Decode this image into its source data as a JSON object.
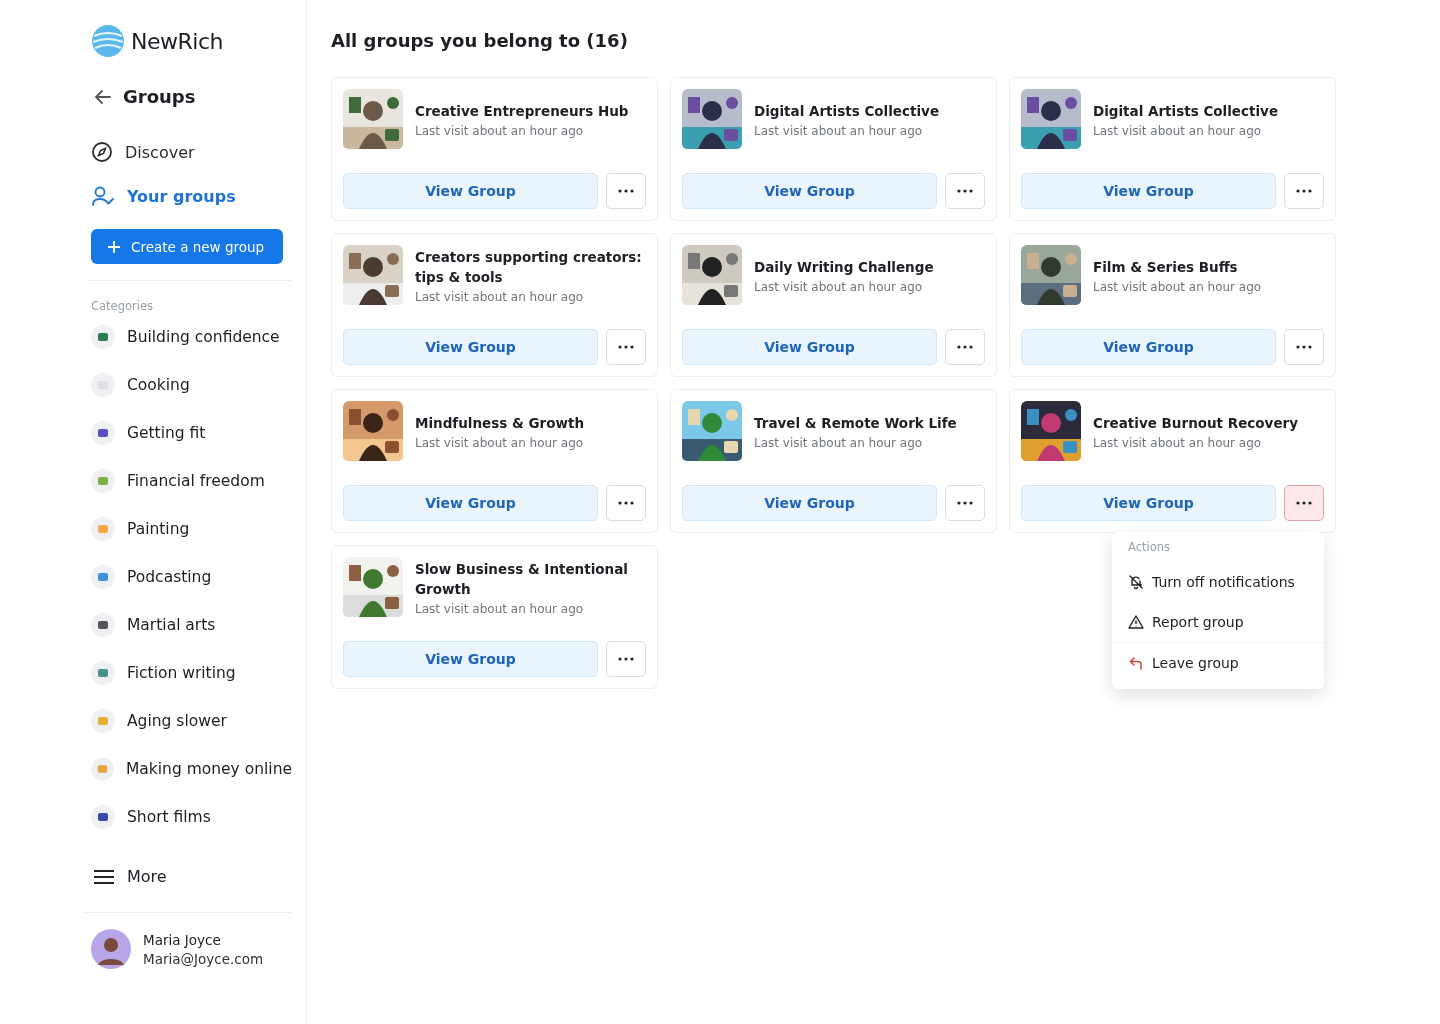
{
  "brand": {
    "name": "NewRich"
  },
  "back": {
    "label": "Groups"
  },
  "nav": [
    {
      "label": "Discover",
      "kind": "compass",
      "selected": false
    },
    {
      "label": "Your groups",
      "kind": "people",
      "selected": true
    }
  ],
  "create_button": {
    "label": "Create a new group"
  },
  "categories": {
    "heading": "Categories",
    "items": [
      {
        "label": "Building confidence"
      },
      {
        "label": "Cooking"
      },
      {
        "label": "Getting fit"
      },
      {
        "label": "Financial freedom"
      },
      {
        "label": "Painting"
      },
      {
        "label": "Podcasting"
      },
      {
        "label": "Martial arts"
      },
      {
        "label": "Fiction writing"
      },
      {
        "label": "Aging slower"
      },
      {
        "label": "Making money online"
      },
      {
        "label": "Short films"
      }
    ]
  },
  "more": {
    "label": "More"
  },
  "user": {
    "name": "Maria Joyce",
    "email": "Maria@Joyce.com"
  },
  "heading": "All groups you belong to (16)",
  "groups": [
    {
      "name": "Creative Entrepreneurs Hub",
      "last_visit": "Last visit about an hour ago",
      "button": "View Group",
      "menu_open": false
    },
    {
      "name": "Digital Artists Collective",
      "last_visit": "Last visit about an hour ago",
      "button": "View Group",
      "menu_open": false
    },
    {
      "name": "Digital Artists Collective",
      "last_visit": "Last visit about an hour ago",
      "button": "View Group",
      "menu_open": false
    },
    {
      "name": "Creators supporting creators: tips & tools",
      "last_visit": "Last visit about an hour ago",
      "button": "View Group",
      "menu_open": false
    },
    {
      "name": "Daily Writing Challenge",
      "last_visit": "Last visit about an hour ago",
      "button": "View Group",
      "menu_open": false
    },
    {
      "name": "Film & Series Buffs",
      "last_visit": "Last visit about an hour ago",
      "button": "View Group",
      "menu_open": false
    },
    {
      "name": "Mindfulness & Growth",
      "last_visit": "Last visit about an hour ago",
      "button": "View Group",
      "menu_open": false
    },
    {
      "name": "Travel & Remote Work Life",
      "last_visit": "Last visit about an hour ago",
      "button": "View Group",
      "menu_open": false
    },
    {
      "name": "Creative Burnout Recovery",
      "last_visit": "Last visit about an hour ago",
      "button": "View Group",
      "menu_open": true
    },
    {
      "name": "Slow Business & Intentional Growth",
      "last_visit": "Last visit about an hour ago",
      "button": "View Group",
      "menu_open": false
    }
  ],
  "menu": {
    "heading": "Actions",
    "items": [
      {
        "label": "Turn off notifications",
        "kind": "mute"
      },
      {
        "label": "Report group",
        "kind": "report"
      },
      {
        "label": "Leave group",
        "kind": "leave"
      }
    ]
  }
}
